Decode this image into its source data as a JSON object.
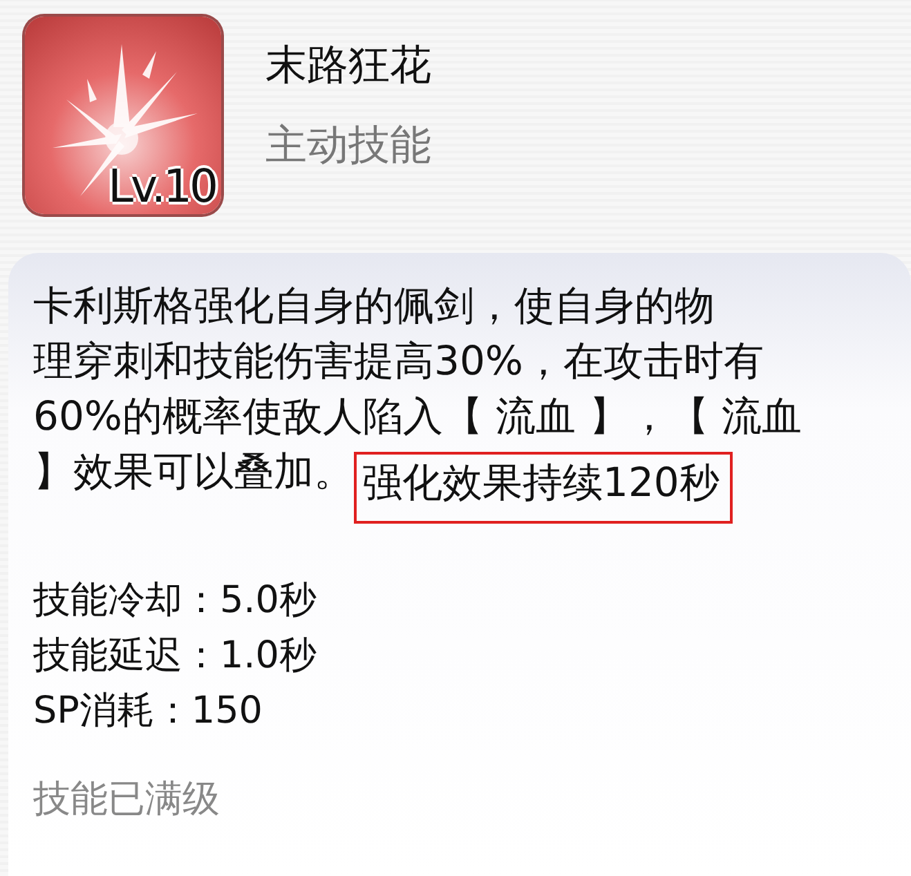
{
  "skill": {
    "name": "末路狂花",
    "type": "主动技能",
    "level": "Lv.10"
  },
  "description": {
    "lines": [
      "卡利斯格强化自身的佩剑，使自身的物",
      "理穿刺和技能伤害提高30%，在攻击时有",
      "60%的概率使敌人陷入【 流血 】，【 流血"
    ],
    "last_line": "】效果可以叠加。",
    "highlight": "强化效果持续120秒"
  },
  "stats": [
    "技能冷却：5.0秒",
    "技能延迟：1.0秒",
    "SP消耗：150"
  ],
  "footer": "技能已满级"
}
